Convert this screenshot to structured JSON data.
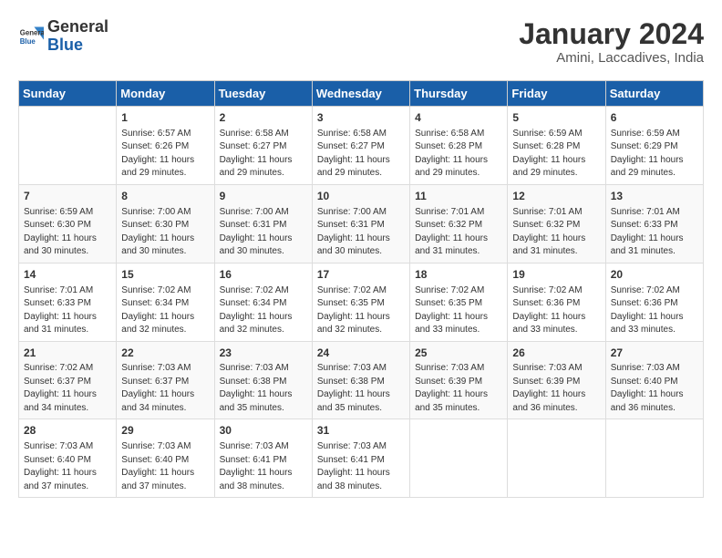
{
  "logo": {
    "line1": "General",
    "line2": "Blue"
  },
  "title": "January 2024",
  "subtitle": "Amini, Laccadives, India",
  "days_header": [
    "Sunday",
    "Monday",
    "Tuesday",
    "Wednesday",
    "Thursday",
    "Friday",
    "Saturday"
  ],
  "weeks": [
    [
      {
        "day": "",
        "info": ""
      },
      {
        "day": "1",
        "info": "Sunrise: 6:57 AM\nSunset: 6:26 PM\nDaylight: 11 hours\nand 29 minutes."
      },
      {
        "day": "2",
        "info": "Sunrise: 6:58 AM\nSunset: 6:27 PM\nDaylight: 11 hours\nand 29 minutes."
      },
      {
        "day": "3",
        "info": "Sunrise: 6:58 AM\nSunset: 6:27 PM\nDaylight: 11 hours\nand 29 minutes."
      },
      {
        "day": "4",
        "info": "Sunrise: 6:58 AM\nSunset: 6:28 PM\nDaylight: 11 hours\nand 29 minutes."
      },
      {
        "day": "5",
        "info": "Sunrise: 6:59 AM\nSunset: 6:28 PM\nDaylight: 11 hours\nand 29 minutes."
      },
      {
        "day": "6",
        "info": "Sunrise: 6:59 AM\nSunset: 6:29 PM\nDaylight: 11 hours\nand 29 minutes."
      }
    ],
    [
      {
        "day": "7",
        "info": "Sunrise: 6:59 AM\nSunset: 6:30 PM\nDaylight: 11 hours\nand 30 minutes."
      },
      {
        "day": "8",
        "info": "Sunrise: 7:00 AM\nSunset: 6:30 PM\nDaylight: 11 hours\nand 30 minutes."
      },
      {
        "day": "9",
        "info": "Sunrise: 7:00 AM\nSunset: 6:31 PM\nDaylight: 11 hours\nand 30 minutes."
      },
      {
        "day": "10",
        "info": "Sunrise: 7:00 AM\nSunset: 6:31 PM\nDaylight: 11 hours\nand 30 minutes."
      },
      {
        "day": "11",
        "info": "Sunrise: 7:01 AM\nSunset: 6:32 PM\nDaylight: 11 hours\nand 31 minutes."
      },
      {
        "day": "12",
        "info": "Sunrise: 7:01 AM\nSunset: 6:32 PM\nDaylight: 11 hours\nand 31 minutes."
      },
      {
        "day": "13",
        "info": "Sunrise: 7:01 AM\nSunset: 6:33 PM\nDaylight: 11 hours\nand 31 minutes."
      }
    ],
    [
      {
        "day": "14",
        "info": "Sunrise: 7:01 AM\nSunset: 6:33 PM\nDaylight: 11 hours\nand 31 minutes."
      },
      {
        "day": "15",
        "info": "Sunrise: 7:02 AM\nSunset: 6:34 PM\nDaylight: 11 hours\nand 32 minutes."
      },
      {
        "day": "16",
        "info": "Sunrise: 7:02 AM\nSunset: 6:34 PM\nDaylight: 11 hours\nand 32 minutes."
      },
      {
        "day": "17",
        "info": "Sunrise: 7:02 AM\nSunset: 6:35 PM\nDaylight: 11 hours\nand 32 minutes."
      },
      {
        "day": "18",
        "info": "Sunrise: 7:02 AM\nSunset: 6:35 PM\nDaylight: 11 hours\nand 33 minutes."
      },
      {
        "day": "19",
        "info": "Sunrise: 7:02 AM\nSunset: 6:36 PM\nDaylight: 11 hours\nand 33 minutes."
      },
      {
        "day": "20",
        "info": "Sunrise: 7:02 AM\nSunset: 6:36 PM\nDaylight: 11 hours\nand 33 minutes."
      }
    ],
    [
      {
        "day": "21",
        "info": "Sunrise: 7:02 AM\nSunset: 6:37 PM\nDaylight: 11 hours\nand 34 minutes."
      },
      {
        "day": "22",
        "info": "Sunrise: 7:03 AM\nSunset: 6:37 PM\nDaylight: 11 hours\nand 34 minutes."
      },
      {
        "day": "23",
        "info": "Sunrise: 7:03 AM\nSunset: 6:38 PM\nDaylight: 11 hours\nand 35 minutes."
      },
      {
        "day": "24",
        "info": "Sunrise: 7:03 AM\nSunset: 6:38 PM\nDaylight: 11 hours\nand 35 minutes."
      },
      {
        "day": "25",
        "info": "Sunrise: 7:03 AM\nSunset: 6:39 PM\nDaylight: 11 hours\nand 35 minutes."
      },
      {
        "day": "26",
        "info": "Sunrise: 7:03 AM\nSunset: 6:39 PM\nDaylight: 11 hours\nand 36 minutes."
      },
      {
        "day": "27",
        "info": "Sunrise: 7:03 AM\nSunset: 6:40 PM\nDaylight: 11 hours\nand 36 minutes."
      }
    ],
    [
      {
        "day": "28",
        "info": "Sunrise: 7:03 AM\nSunset: 6:40 PM\nDaylight: 11 hours\nand 37 minutes."
      },
      {
        "day": "29",
        "info": "Sunrise: 7:03 AM\nSunset: 6:40 PM\nDaylight: 11 hours\nand 37 minutes."
      },
      {
        "day": "30",
        "info": "Sunrise: 7:03 AM\nSunset: 6:41 PM\nDaylight: 11 hours\nand 38 minutes."
      },
      {
        "day": "31",
        "info": "Sunrise: 7:03 AM\nSunset: 6:41 PM\nDaylight: 11 hours\nand 38 minutes."
      },
      {
        "day": "",
        "info": ""
      },
      {
        "day": "",
        "info": ""
      },
      {
        "day": "",
        "info": ""
      }
    ]
  ]
}
